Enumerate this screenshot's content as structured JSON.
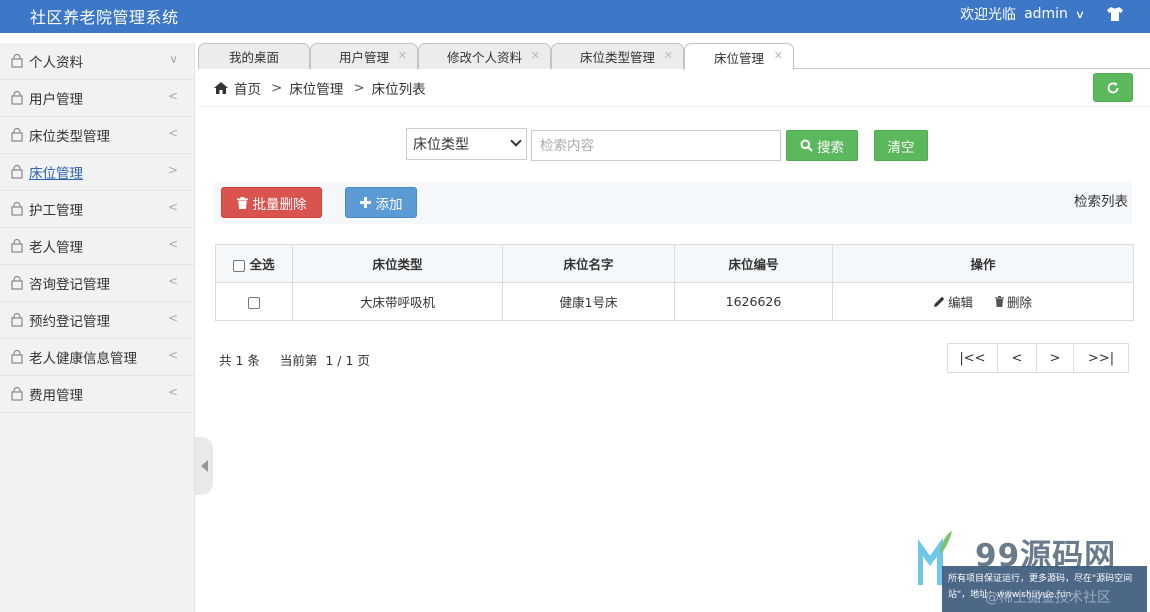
{
  "header": {
    "app_title": "社区养老院管理系统",
    "welcome_text": "欢迎光临",
    "username": "admin",
    "accent_color": "#3c77c8"
  },
  "sidebar": {
    "items": [
      {
        "label": "个人资料",
        "arrow": "∨"
      },
      {
        "label": "用户管理",
        "arrow": "<"
      },
      {
        "label": "床位类型管理",
        "arrow": "<"
      },
      {
        "label": "床位管理",
        "arrow": ">"
      },
      {
        "label": "护工管理",
        "arrow": "<"
      },
      {
        "label": "老人管理",
        "arrow": "<"
      },
      {
        "label": "咨询登记管理",
        "arrow": "<"
      },
      {
        "label": "预约登记管理",
        "arrow": "<"
      },
      {
        "label": "老人健康信息管理",
        "arrow": "<"
      },
      {
        "label": "费用管理",
        "arrow": "<"
      }
    ],
    "active_index": 3
  },
  "tabs": [
    {
      "label": "我的桌面",
      "closable": false
    },
    {
      "label": "用户管理",
      "closable": true
    },
    {
      "label": "修改个人资料",
      "closable": true
    },
    {
      "label": "床位类型管理",
      "closable": true
    },
    {
      "label": "床位管理",
      "closable": true,
      "active": true
    }
  ],
  "breadcrumb": {
    "home": "首页",
    "sep": ">",
    "level1": "床位管理",
    "level2": "床位列表"
  },
  "search": {
    "select_value": "床位类型",
    "input_placeholder": "检索内容",
    "search_label": "搜索",
    "clear_label": "清空"
  },
  "actions": {
    "batch_delete_label": "批量删除",
    "add_label": "添加",
    "list_caption": "检索列表"
  },
  "table": {
    "select_all_label": "全选",
    "columns": [
      "床位类型",
      "床位名字",
      "床位编号",
      "操作"
    ],
    "rows": [
      {
        "type": "大床带呼吸机",
        "name": "健康1号床",
        "number": "1626626"
      }
    ],
    "edit_label": "编辑",
    "delete_label": "删除"
  },
  "pager": {
    "total": "共 1 条",
    "current": "当前第  1 / 1 页",
    "first": "|<<",
    "prev": "<",
    "next": ">",
    "last": ">>|"
  },
  "watermark": {
    "brand": "99源码网",
    "note": "所有项目保证运行，更多源码，尽在\"源码空间站\"，地址：www.shuyue.fun",
    "overlay": "@稀土掘金技术社区"
  },
  "colors": {
    "success": "#5cb85c",
    "danger": "#d9534f",
    "primary": "#5b9bd5"
  },
  "icons": [
    "shirt-icon",
    "bag-icon",
    "home-icon",
    "refresh-icon",
    "search-icon",
    "trash-icon",
    "plus-icon",
    "pencil-icon"
  ]
}
